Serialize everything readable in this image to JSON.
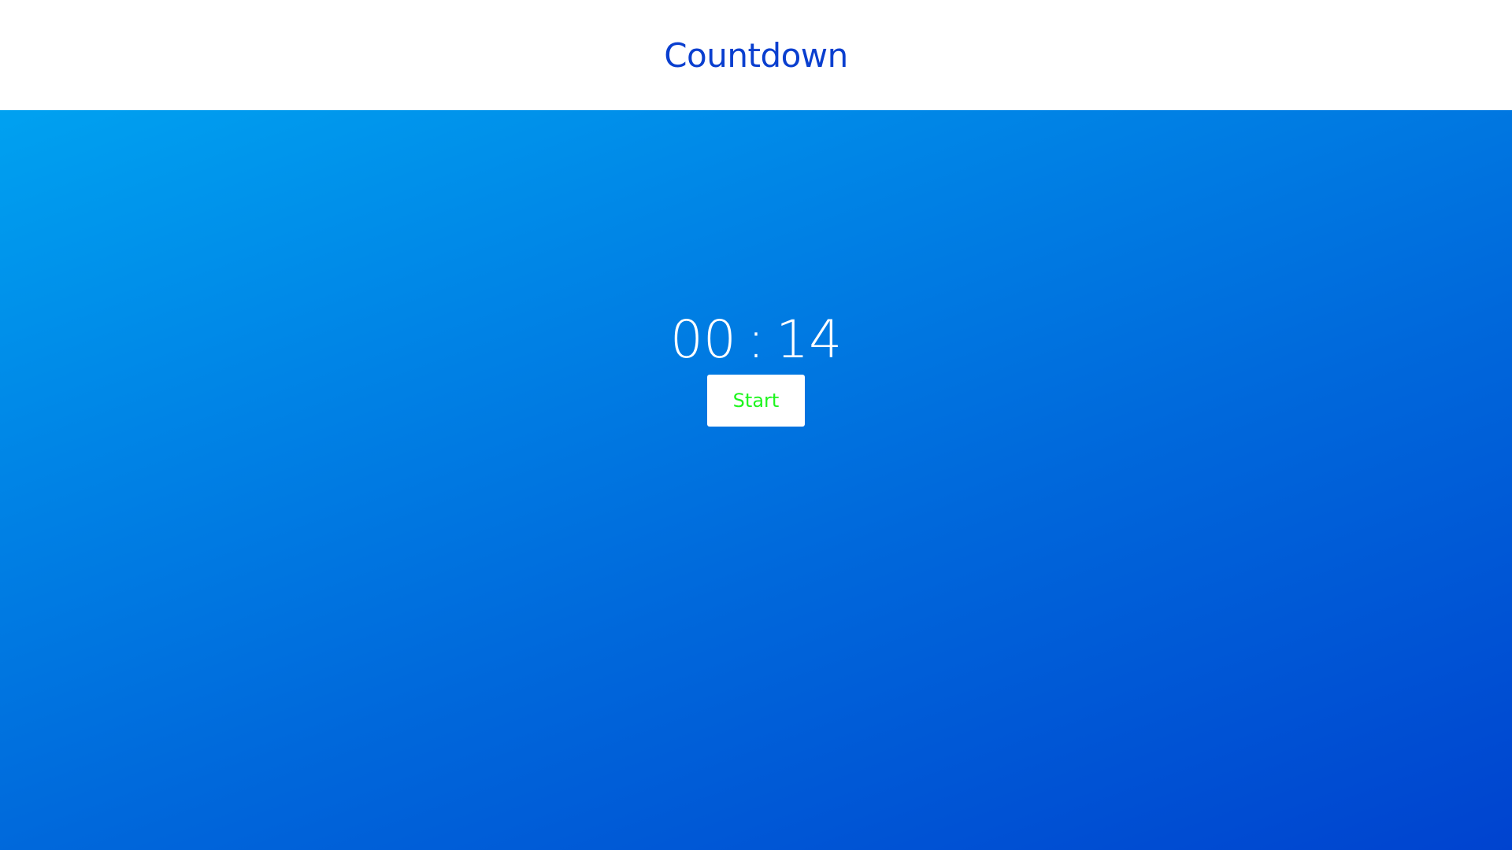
{
  "header": {
    "title": "Countdown"
  },
  "timer": {
    "minutes": "00",
    "separator": ":",
    "seconds": "14"
  },
  "controls": {
    "start_label": "Start"
  },
  "colors": {
    "title": "#0a3fcf",
    "background_gradient_start": "#00a1f0",
    "background_gradient_end": "#0043cf",
    "start_button_text": "#1ef51e",
    "timer_text": "#ffffff"
  }
}
